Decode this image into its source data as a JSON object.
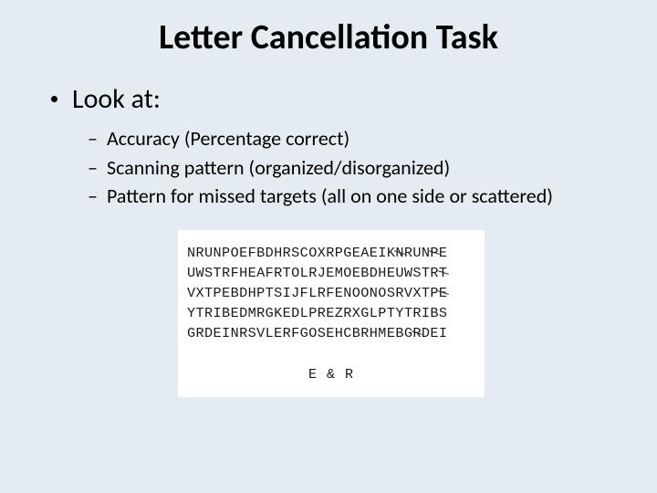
{
  "title": "Letter Cancellation Task",
  "lookAt": {
    "label": "Look at:",
    "items": [
      "Accuracy (Percentage correct)",
      "Scanning pattern (organized/disorganized)",
      "Pattern for missed targets (all on one side or scattered)"
    ]
  },
  "letterGrid": {
    "rows": [
      "NRUNPOEFBDHRSCOXRPGEAEIKNRUNPE",
      "UWSTRFHEAFRTOLRJEMOEBDHEUWSTRT",
      "VXTPEBDHPTSIJFLRFENOONOSRVXTPE",
      "YTRIBEDMRGKEDLPREZRXGLPTYTRIBS",
      "GRDEINRSVLERFGOSEHCBRHMEBGRDEI"
    ],
    "cancelPositions": [
      [
        24,
        28
      ],
      [
        29
      ],
      [
        29
      ],
      [],
      [
        26
      ]
    ],
    "targetsLabel": "E & R"
  }
}
